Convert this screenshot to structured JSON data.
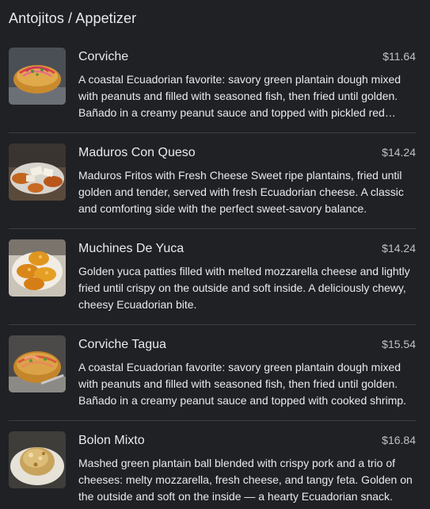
{
  "section": {
    "title": "Antojitos / Appetizer"
  },
  "items": [
    {
      "name": "Corviche",
      "price": "$11.64",
      "description": "A coastal Ecuadorian favorite: savory green plantain dough mixed with peanuts and filled with seasoned fish, then fried until golden. Bañado in a creamy peanut sauce and topped with pickled red onions.",
      "image_icon": "corviche-photo"
    },
    {
      "name": "Maduros Con Queso",
      "price": "$14.24",
      "description": "Maduros Fritos with Fresh Cheese Sweet ripe plantains, fried until golden and tender, served with fresh Ecuadorian cheese. A classic and comforting side with the perfect sweet-savory balance.",
      "image_icon": "maduros-photo"
    },
    {
      "name": "Muchines De Yuca",
      "price": "$14.24",
      "description": "Golden yuca patties filled with melted mozzarella cheese and lightly fried until crispy on the outside and soft inside. A deliciously chewy, cheesy Ecuadorian bite.",
      "image_icon": "muchines-photo"
    },
    {
      "name": "Corviche Tagua",
      "price": "$15.54",
      "description": "A coastal Ecuadorian favorite: savory green plantain dough mixed with peanuts and filled with seasoned fish, then fried until golden. Bañado in a creamy peanut sauce and topped with cooked shrimp.",
      "image_icon": "corviche-tagua-photo"
    },
    {
      "name": "Bolon Mixto",
      "price": "$16.84",
      "description": "Mashed green plantain ball blended with crispy pork and a trio of cheeses: melty mozzarella, fresh cheese, and tangy feta. Golden on the outside and soft on the inside — a hearty Ecuadorian snack.",
      "image_icon": "bolon-photo"
    }
  ],
  "colors": {
    "background": "#202124",
    "divider": "#3c4043",
    "text": "#e8eaed",
    "price": "#bdc1c6"
  }
}
